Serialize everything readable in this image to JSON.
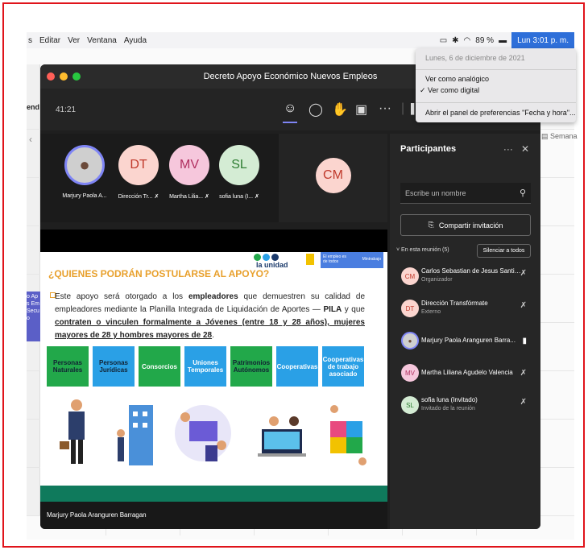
{
  "menubar": {
    "items": [
      "s",
      "Editar",
      "Ver",
      "Ventana",
      "Ayuda"
    ],
    "battery": "89 %",
    "clock": "Lun 3:01 p. m."
  },
  "clock_menu": {
    "date": "Lunes, 6 de diciembre de 2021",
    "option_analog": "Ver como analógico",
    "option_digital": "✓ Ver como digital",
    "prefs": "Abrir el panel de preferencias \"Fecha y hora\"..."
  },
  "background": {
    "label_left": "end",
    "semana": "Semana",
    "side_text": "o Ap\ns Em\nSecu\no"
  },
  "window": {
    "title": "Decreto Apoyo Económico Nuevos Empleos",
    "timer": "41:21"
  },
  "participants_tiles": [
    {
      "name": "Marjury Paola A...",
      "initials": "",
      "bg": "#cfcfcf",
      "fg": "#333"
    },
    {
      "name": "Dirección Tr...",
      "initials": "DT",
      "bg": "#fbd5cf",
      "fg": "#c0392b"
    },
    {
      "name": "Martha Lilia...",
      "initials": "MV",
      "bg": "#f6c7dc",
      "fg": "#b03060"
    },
    {
      "name": "sofia luna (I...",
      "initials": "SL",
      "bg": "#d4ecd4",
      "fg": "#2e7d32"
    },
    {
      "name": "",
      "initials": "CM",
      "bg": "#fbd5cf",
      "fg": "#c0392b"
    }
  ],
  "slide": {
    "title": "¿QUIENES PODRÁN POSTULARSE AL APOYO?",
    "brand": "la unidad",
    "brand_tag": "El empleo es de todos",
    "brand_ministry": "Mintrabajo",
    "text_1": "Este apoyo será otorgado a los ",
    "text_bold_1": "empleadores",
    "text_2": " que demuestren su calidad de empleadores mediante la Planilla Integrada de Liquidación de Aportes — ",
    "text_bold_2": "PILA",
    "text_3": " y que ",
    "text_bold_3": "contraten o vinculen formalmente a Jóvenes (entre 18 y 28 años), mujeres mayores de 28 y hombres mayores de 28",
    "text_4": ".",
    "boxes": [
      {
        "label": "Personas Naturales",
        "bg": "#22a84a",
        "fg": "#123"
      },
      {
        "label": "Personas Jurídicas",
        "bg": "#2aa0e6",
        "fg": "#123"
      },
      {
        "label": "Consorcios",
        "bg": "#22a84a",
        "fg": "#fff"
      },
      {
        "label": "Uniones Temporales",
        "bg": "#2aa0e6",
        "fg": "#fff"
      },
      {
        "label": "Patrimonios Autónomos",
        "bg": "#22a84a",
        "fg": "#123"
      },
      {
        "label": "Cooperativas",
        "bg": "#2aa0e6",
        "fg": "#fff"
      },
      {
        "label": "Cooperativas de trabajo asociado",
        "bg": "#2aa0e6",
        "fg": "#fff"
      }
    ]
  },
  "presenter": "Marjury Paola Aranguren Barragan",
  "panel": {
    "title": "Participantes",
    "search_placeholder": "Escribe un nombre",
    "invite": "Compartir invitación",
    "in_meeting": "En esta reunión (5)",
    "silence_all": "Silenciar a todos",
    "people": [
      {
        "initials": "CM",
        "name": "Carlos Sebastian de Jesus Santiz...",
        "sub": "Organizador",
        "bg": "#fbd5cf",
        "fg": "#c0392b",
        "icon": "mic-off"
      },
      {
        "initials": "DT",
        "name": "Dirección Transfórmate",
        "sub": "Externo",
        "bg": "#fbd5cf",
        "fg": "#c0392b",
        "icon": "mic-off"
      },
      {
        "initials": "",
        "name": "Marjury Paola Aranguren Barra...",
        "sub": "",
        "bg": "#cfcfcf",
        "fg": "#333",
        "icon": "mic-on"
      },
      {
        "initials": "MV",
        "name": "Martha Liliana Agudelo Valencia",
        "sub": "",
        "bg": "#f6c7dc",
        "fg": "#b03060",
        "icon": "mic-off"
      },
      {
        "initials": "SL",
        "name": "sofia luna (Invitado)",
        "sub": "Invitado de la reunión",
        "bg": "#d4ecd4",
        "fg": "#2e7d32",
        "icon": "mic-off"
      }
    ]
  }
}
